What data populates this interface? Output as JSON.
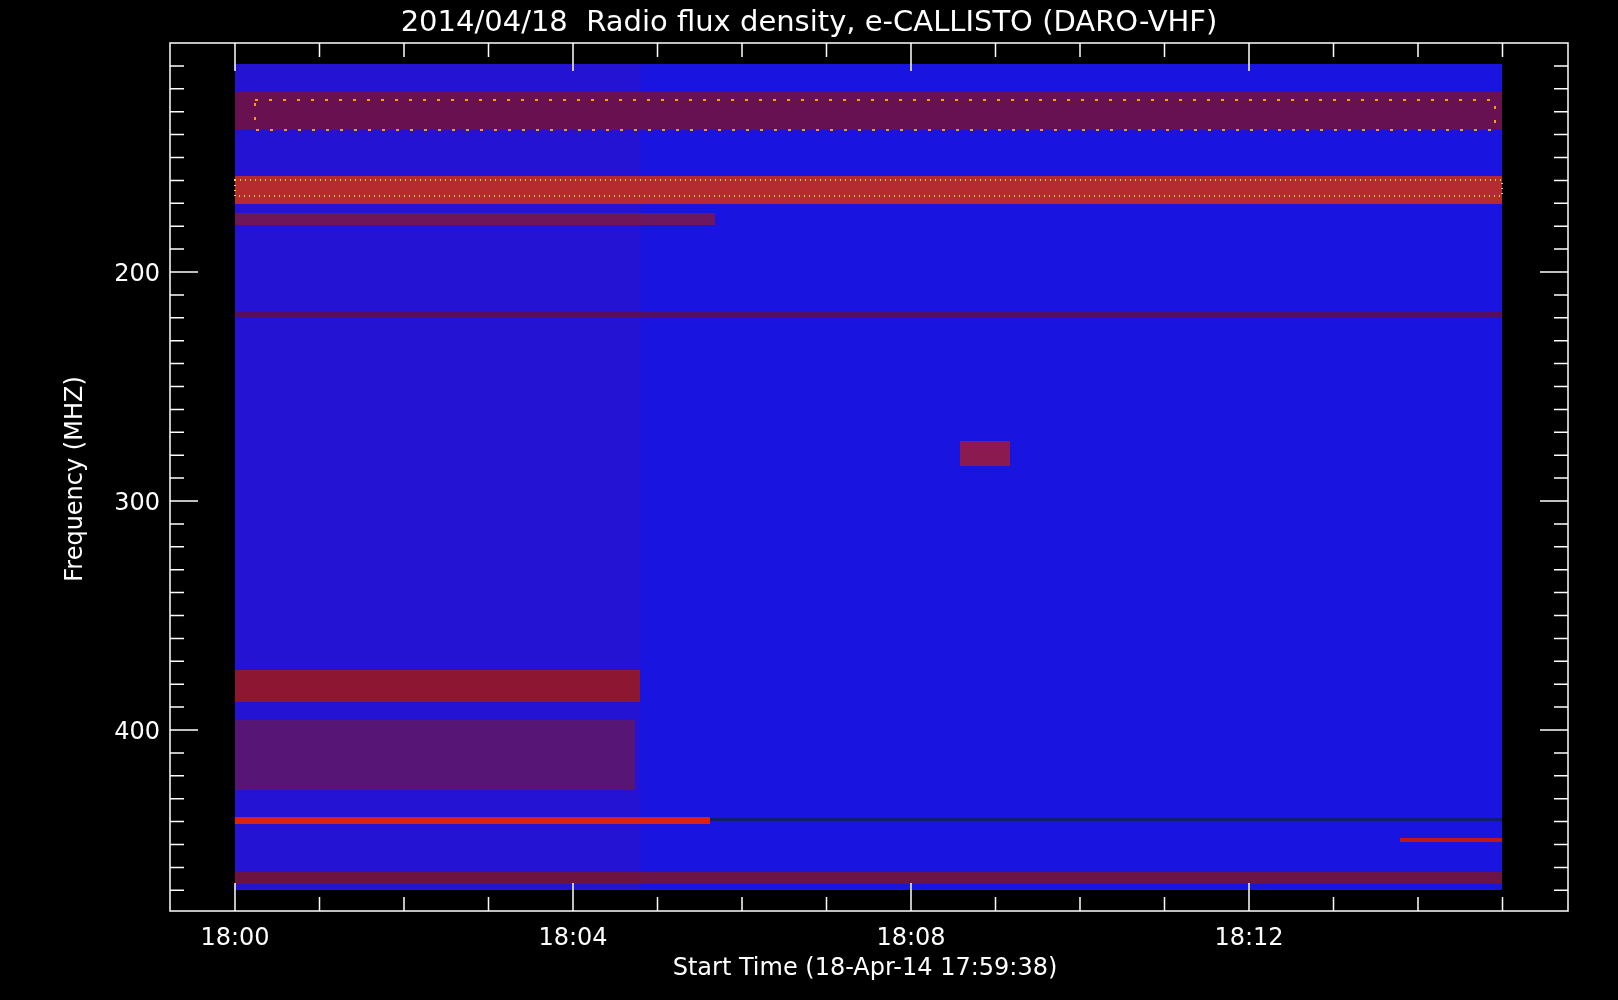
{
  "title": "2014/04/18  Radio flux density, e-CALLISTO (DARO-VHF)",
  "ylabel": "Frequency (MHZ)",
  "yticks": [
    "200",
    "300",
    "400"
  ],
  "xticks": [
    "18:00",
    "18:04",
    "18:08",
    "18:12"
  ],
  "xlabel": "Start Time (18-Apr-14 17:59:38)"
}
